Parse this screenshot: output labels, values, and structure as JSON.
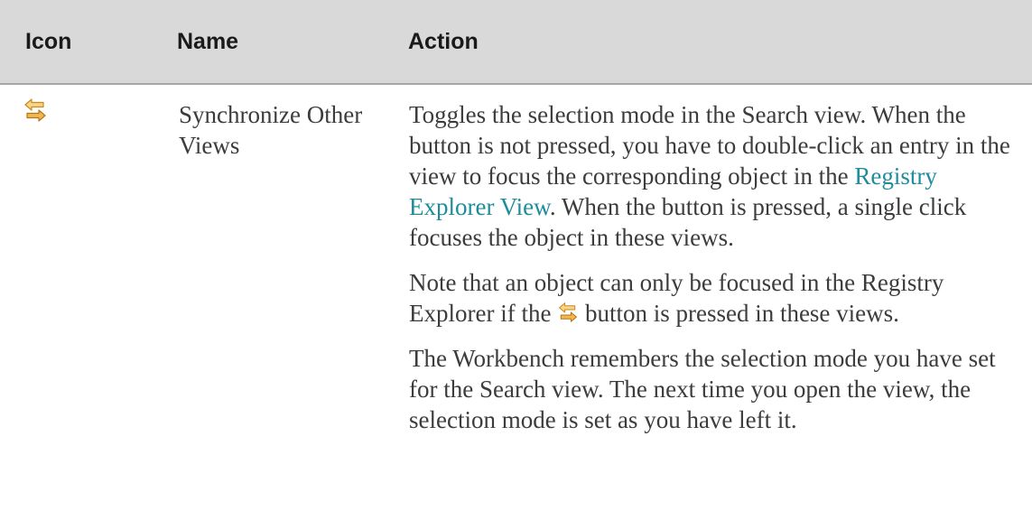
{
  "table": {
    "headers": {
      "icon": "Icon",
      "name": "Name",
      "action": "Action"
    },
    "row": {
      "icon_name": "synchronize-icon",
      "name": "Synchronize Other Views",
      "action": {
        "p1_before_link": "Toggles the selection mode in the Search view. When the button is not pressed, you have to double-click an entry in the view to focus the corresponding object in the ",
        "p1_link": "Registry Explorer View",
        "p1_after_link": ". When the button is pressed, a single click focuses the object in these views.",
        "p2_before_icon": "Note that an object can only be focused in the Registry Explorer if the ",
        "p2_after_icon": " button is pressed in these views.",
        "p3": "The Workbench remembers the selection mode you have set for the Search view. The next time you open the view, the selection mode is set as you have left it."
      }
    }
  },
  "colors": {
    "header_background": "#d9d9d9",
    "link": "#1e8c9b",
    "icon_arrow": "#f2b84b"
  }
}
